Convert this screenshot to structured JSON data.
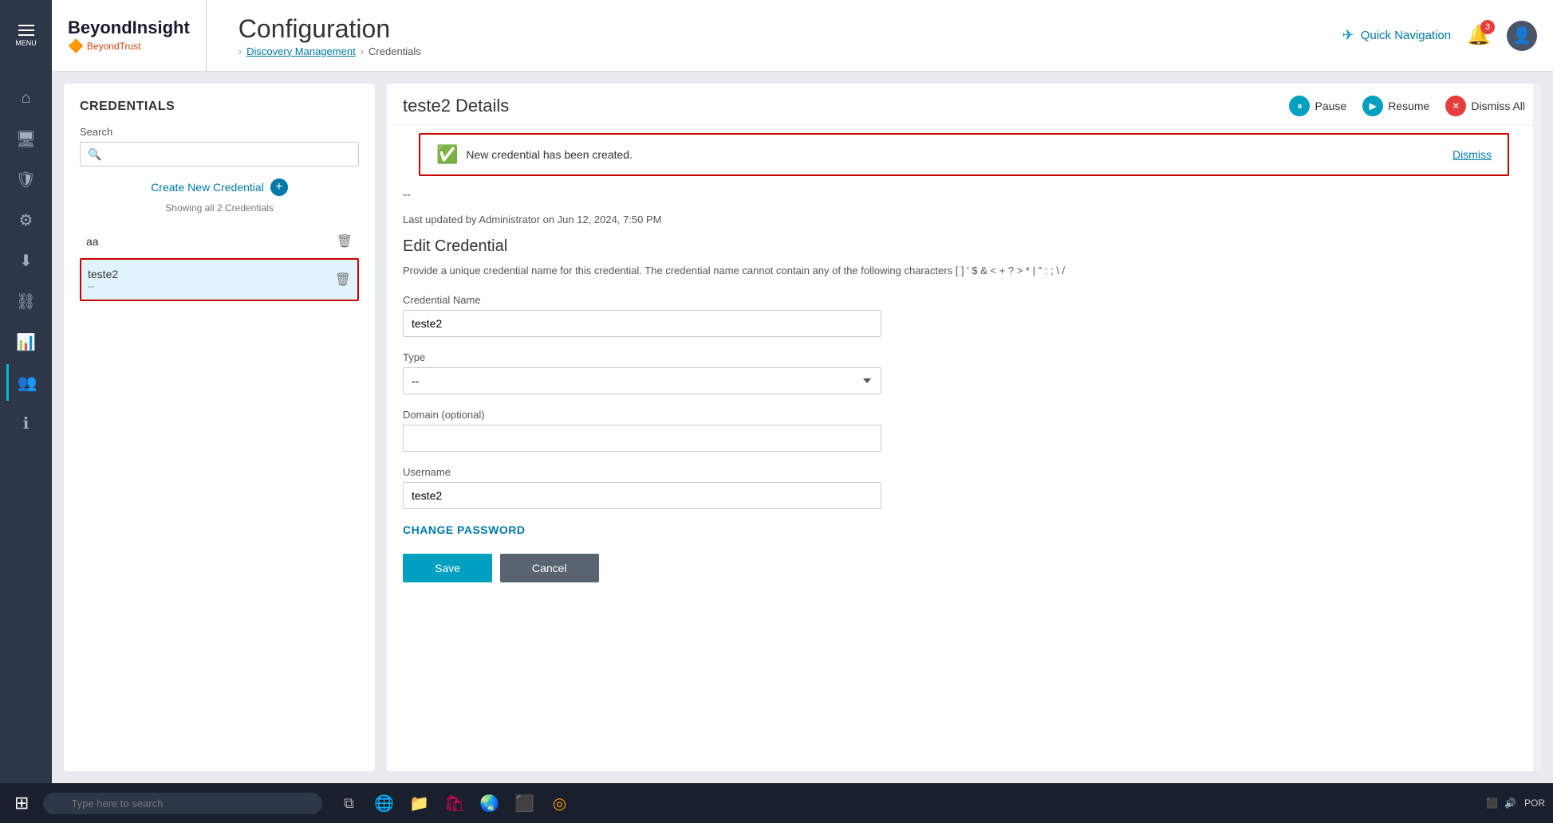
{
  "app": {
    "name": "BeyondInsight",
    "sub": "BeyondTrust",
    "page_title": "Configuration",
    "breadcrumb": {
      "parent": "Discovery Management",
      "current": "Credentials"
    }
  },
  "header": {
    "menu_label": "MENU",
    "quick_nav": "Quick Navigation",
    "notif_count": "3"
  },
  "sidebar": {
    "items": [
      {
        "icon": "⌂",
        "name": "home"
      },
      {
        "icon": "🖥",
        "name": "desktop"
      },
      {
        "icon": "🛡",
        "name": "shield"
      },
      {
        "icon": "⚙",
        "name": "settings-gear"
      },
      {
        "icon": "⬇",
        "name": "download"
      },
      {
        "icon": "🔗",
        "name": "link"
      },
      {
        "icon": "📊",
        "name": "chart"
      },
      {
        "icon": "👥",
        "name": "users"
      },
      {
        "icon": "ℹ",
        "name": "info"
      }
    ],
    "active_index": 7
  },
  "credentials_panel": {
    "title": "CREDENTIALS",
    "search_label": "Search",
    "search_placeholder": "",
    "create_new_label": "Create New Credential",
    "showing_label": "Showing all 2 Credentials",
    "items": [
      {
        "name": "aa",
        "sub": "",
        "id": "aa"
      },
      {
        "name": "teste2",
        "sub": "--",
        "id": "teste2",
        "selected": true
      }
    ]
  },
  "details_panel": {
    "title": "teste2 Details",
    "sub_text": "--",
    "last_updated": "Last updated by Administrator on Jun 12, 2024, 7:50 PM",
    "actions": {
      "pause": "Pause",
      "resume": "Resume",
      "dismiss_all": "Dismiss All"
    },
    "notification": {
      "message": "New credential has been created.",
      "dismiss_label": "Dismiss"
    },
    "edit_section": {
      "title": "Edit Credential",
      "description": "Provide a unique credential name for this credential. The credential name cannot contain any of the following characters [ ] ' $ & < + ? > * | \" : ; \\ /",
      "credential_name_label": "Credential Name",
      "credential_name_value": "teste2",
      "type_label": "Type",
      "type_value": "--",
      "domain_label": "Domain (optional)",
      "domain_value": "",
      "username_label": "Username",
      "username_value": "teste2",
      "change_password_label": "CHANGE PASSWORD"
    }
  },
  "taskbar": {
    "search_placeholder": "Type here to search",
    "lang": "POR"
  }
}
